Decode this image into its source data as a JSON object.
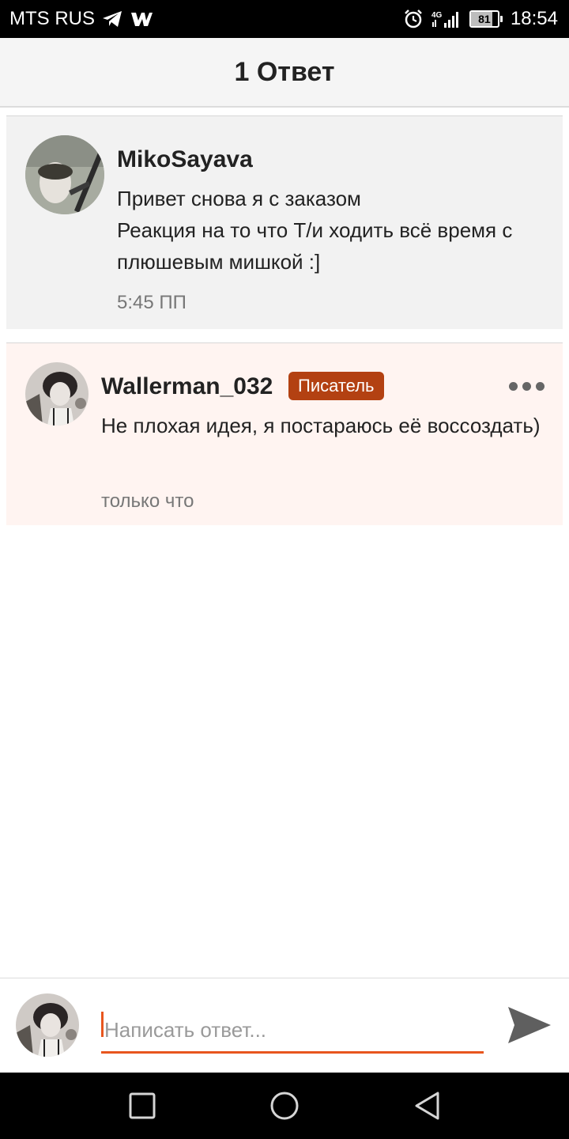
{
  "status_bar": {
    "carrier": "MTS RUS",
    "network": "4G",
    "battery": "81",
    "battery_level": 0.81,
    "time": "18:54",
    "icons": [
      "telegram-icon",
      "wattpad-icon",
      "alarm-icon",
      "signal-icon",
      "battery-icon"
    ]
  },
  "header": {
    "title": "1 Ответ"
  },
  "parent_comment": {
    "author": "MikoSayava",
    "text": "Привет снова я с заказом\nРеакция на то что Т/и ходить всё время с плюшевым мишкой :]",
    "time": "5:45 ПП"
  },
  "reply_comment": {
    "author": "Wallerman_032",
    "badge": "Писатель",
    "text": "Не плохая идея, я постараюсь её воссоздать)",
    "time": "только что"
  },
  "composer": {
    "placeholder": "Написать ответ..."
  },
  "colors": {
    "accent": "#e8561e",
    "badge": "#b34112",
    "reply_background": "#fff4f1",
    "parent_background": "#f2f2f2"
  }
}
